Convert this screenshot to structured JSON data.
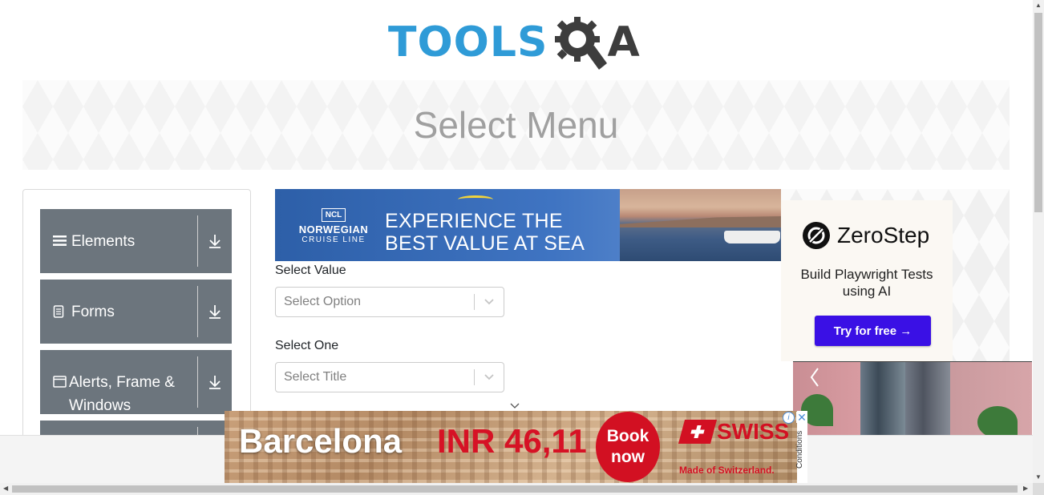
{
  "logo": {
    "part1": "TOOLS",
    "part2": "A",
    "brand_blue": "#2f9bd7",
    "brand_dark": "#3d3d3d"
  },
  "banner": {
    "title": "Select Menu"
  },
  "sidebar": {
    "groups": [
      {
        "label": "Elements",
        "icon": "hamburger-icon"
      },
      {
        "label": "Forms",
        "icon": "document-icon"
      },
      {
        "label": "Alerts, Frame & Windows",
        "icon": "window-icon"
      },
      {
        "label": "",
        "icon": ""
      }
    ],
    "group_color": "#6c757d"
  },
  "ad_top": {
    "brand_badge": "NCL",
    "brand_name": "NORWEGIAN",
    "brand_sub": "CRUISE LINE",
    "line1": "EXPERIENCE THE",
    "line2": "BEST VALUE AT SEA"
  },
  "form": {
    "select_value": {
      "label": "Select Value",
      "placeholder": "Select Option"
    },
    "select_one": {
      "label": "Select One",
      "placeholder": "Select Title"
    }
  },
  "ad_right": {
    "brand": "ZeroStep",
    "tagline": "Build Playwright Tests using AI",
    "cta": "Try for free →",
    "cta_color": "#3a10e5"
  },
  "ad_bottom": {
    "city": "Barcelona",
    "price": "INR 46,11",
    "book_line1": "Book",
    "book_line2": "now",
    "airline": "SWISS",
    "airline_tag": "Made of Switzerland.",
    "conditions": "Conditions",
    "accent": "#d21022"
  }
}
